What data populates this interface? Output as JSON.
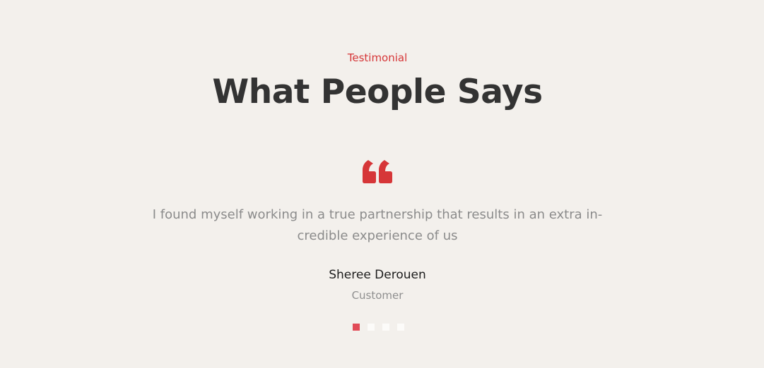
{
  "section": {
    "eyebrow": "Testimonial",
    "title": "What People Says"
  },
  "testimonial": {
    "quote_icon": "quote-left-icon",
    "text": "I found myself working in a true partnership that results in an extra in-credible experience of us",
    "author": "Sheree Derouen",
    "role": "Customer"
  },
  "carousel": {
    "slide_count": 4,
    "active_index": 0,
    "active_color": "#e14b57",
    "inactive_color": "#ffffff"
  },
  "colors": {
    "background": "#f3f0ec",
    "accent": "#d63638",
    "heading": "#333333",
    "body_text": "#8b8b8b"
  }
}
